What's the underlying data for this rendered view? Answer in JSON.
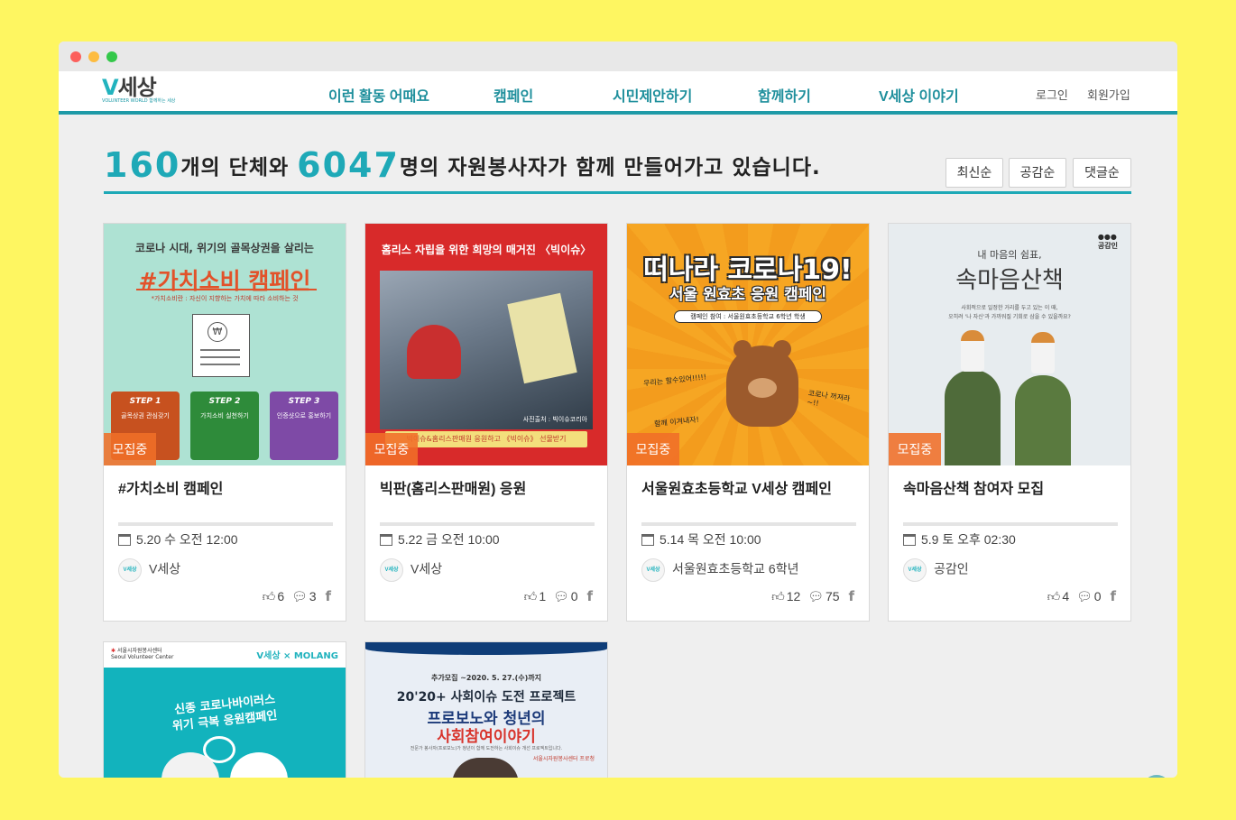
{
  "header": {
    "logo_text": "V세상",
    "logo_tagline": "VOLUNTEER WORLD 함께하는 세상",
    "nav": [
      "이런 활동 어때요",
      "캠페인",
      "시민제안하기",
      "함께하기",
      "V세상 이야기"
    ],
    "login": "로그인",
    "signup": "회원가입"
  },
  "summary": {
    "org_count": "160",
    "org_suffix": "개의 단체와",
    "volunteer_count": "6047",
    "volunteer_suffix": "명의 자원봉사자가 함께 만들어가고 있습니다."
  },
  "sort": [
    "최신순",
    "공감순",
    "댓글순"
  ],
  "cards": [
    {
      "badge": "모집중",
      "title": "#가치소비 캠페인",
      "date": "5.20 수 오전 12:00",
      "org": "V세상",
      "likes": "6",
      "comments": "3",
      "thumb": {
        "line1": "코로나 시대, 위기의 골목상권을 살리는",
        "line2": "#가치소비 캠페인",
        "line3": "*가치소비란 : 자신이 지향하는 가치에 따라 소비하는 것",
        "step1": "STEP 1",
        "step1_text": "골목상권 관심갖기",
        "step2": "STEP 2",
        "step2_text": "가치소비 실천하기",
        "step3": "STEP 3",
        "step3_text": "인증샷으로 홍보하기"
      }
    },
    {
      "badge": "모집중",
      "title": "빅판(홈리스판매원) 응원",
      "date": "5.22 금 오전 10:00",
      "org": "V세상",
      "likes": "1",
      "comments": "0",
      "thumb": {
        "line1": "홈리스 자립을 위한 희망의 매거진 〈빅이슈〉",
        "caption": "사진출처 : 빅이슈코리아",
        "footer": "빅이슈&홈리스판매원 응원하고 《빅이슈》 선물받기"
      }
    },
    {
      "badge": "모집중",
      "title": "서울원효초등학교 V세상 캠페인",
      "date": "5.14 목 오전 10:00",
      "org": "서울원효초등학교 6학년",
      "likes": "12",
      "comments": "75",
      "thumb": {
        "line1": "떠나라 코로나19!",
        "line2": "서울 원효초 응원 캠페인",
        "line3": "캠페인 참여 : 서울원효초등학교 6학년 학생",
        "bubble1": "우리는 할수있어!!!!!",
        "bubble2": "함께 이겨내자!",
        "bubble3": "코로나 꺼져라~!!"
      }
    },
    {
      "badge": "모집중",
      "title": "속마음산책 참여자 모집",
      "date": "5.9 토 오후 02:30",
      "org": "공감인",
      "likes": "4",
      "comments": "0",
      "thumb": {
        "brand": "공감인",
        "line1": "내 마음의 쉼표,",
        "line2": "속마음산책",
        "line3": "사회적으로 일정한 거리를 두고 있는 이 때,",
        "line4": "오히려 '나 자신'과 가까워질 기회로 삼을 수 있을까요?"
      }
    },
    {
      "thumb": {
        "top_org": "서울시자원봉사센터",
        "top_org_en": "Seoul Volunteer Center",
        "top_brand": "V세상 × MOLANG",
        "line1": "신종 코로나바이러스",
        "line2": "위기 극복 응원캠페인"
      }
    },
    {
      "thumb": {
        "line0": "추가모집 ~2020. 5. 27.(수)까지",
        "line1": "20'20+ 사회이슈 도전 프로젝트",
        "line2": "프로보노와 청년의",
        "line3": "사회참여이야기",
        "line4": "전문가 봉사자(프로보노)가 청년이 함께 도전하는 사회이슈 개선 프로젝트입니다.",
        "org": "서울시자원봉사센터 프로청"
      }
    }
  ],
  "icons": {
    "calendar": "calendar-icon",
    "like": "thumbs-up-icon",
    "comment": "comment-icon",
    "facebook": "facebook-icon",
    "scroll_top": "chevron-up-icon"
  },
  "colors": {
    "background": "#fef661",
    "accent": "#1ea9b7",
    "badge": "#f06e28"
  }
}
